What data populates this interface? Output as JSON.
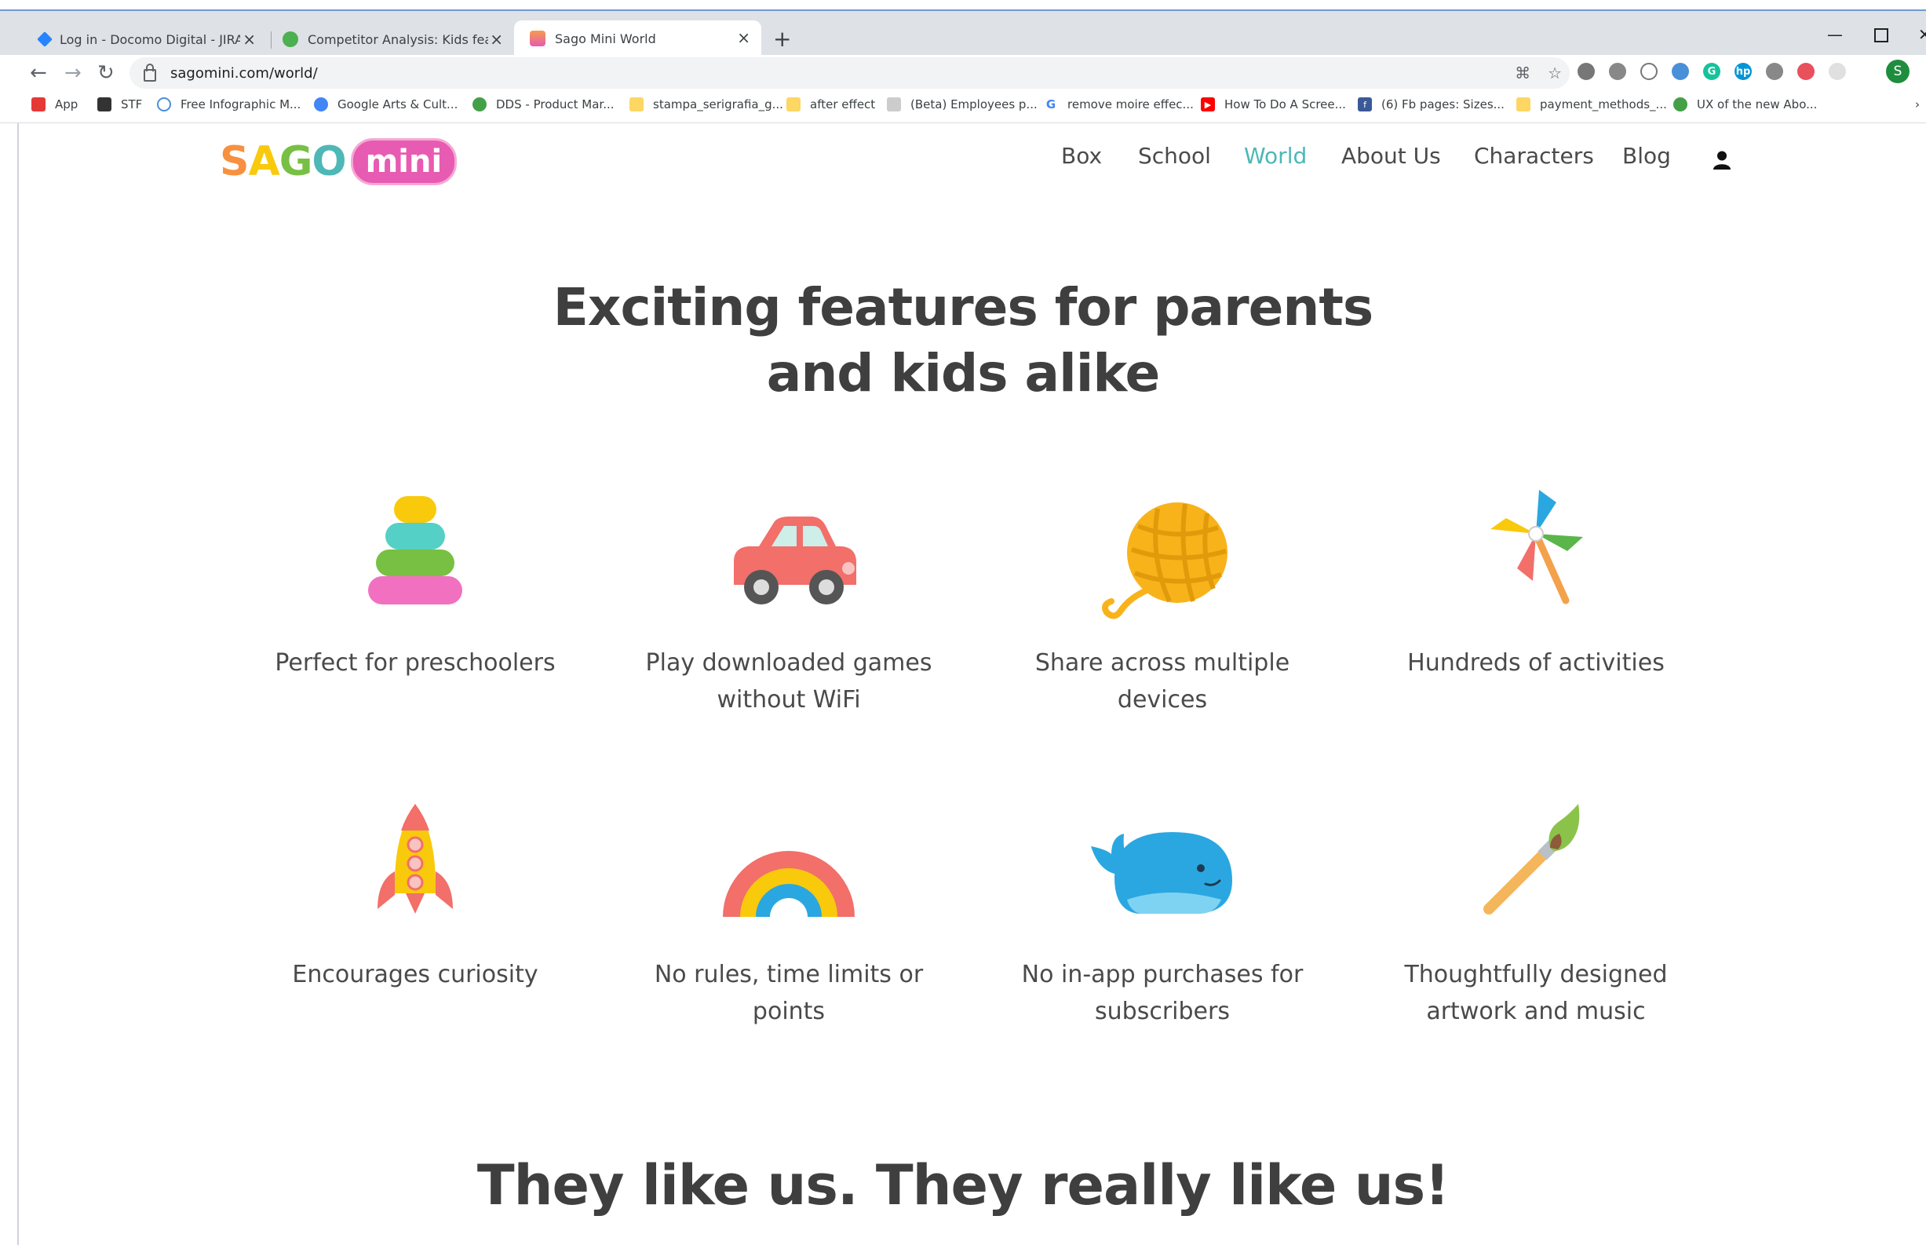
{
  "browser": {
    "tabs": [
      {
        "title": "Log in - Docomo Digital - JIRA"
      },
      {
        "title": "Competitor Analysis: Kids feature"
      },
      {
        "title": "Sago Mini World"
      }
    ],
    "url": "sagomini.com/world/",
    "profile_initial": "S",
    "bookmarks": [
      {
        "label": "App"
      },
      {
        "label": "STF"
      },
      {
        "label": "Free Infographic M..."
      },
      {
        "label": "Google Arts & Cult..."
      },
      {
        "label": "DDS - Product Mar..."
      },
      {
        "label": "stampa_serigrafia_g..."
      },
      {
        "label": "after effect"
      },
      {
        "label": "(Beta) Employees p..."
      },
      {
        "label": "remove moire effec..."
      },
      {
        "label": "How To Do A Scree..."
      },
      {
        "label": "(6) Fb pages: Sizes..."
      },
      {
        "label": "payment_methods_..."
      },
      {
        "label": "UX of the new Abo..."
      }
    ]
  },
  "site": {
    "logo": {
      "sago": "SAGO",
      "mini": "mini"
    },
    "nav": [
      {
        "label": "Box",
        "active": false
      },
      {
        "label": "School",
        "active": false
      },
      {
        "label": "World",
        "active": true
      },
      {
        "label": "About Us",
        "active": false
      },
      {
        "label": "Characters",
        "active": false
      },
      {
        "label": "Blog",
        "active": false
      }
    ],
    "nav_active_color": "#4db8b6"
  },
  "features_section": {
    "title_line1": "Exciting features for parents",
    "title_line2": "and kids alike",
    "features": [
      {
        "icon": "stacking-rings-icon",
        "line1": "Perfect for preschoolers",
        "line2": ""
      },
      {
        "icon": "toy-car-icon",
        "line1": "Play downloaded games",
        "line2": "without WiFi"
      },
      {
        "icon": "yarn-ball-icon",
        "line1": "Share across multiple",
        "line2": "devices"
      },
      {
        "icon": "pinwheel-icon",
        "line1": "Hundreds of activities",
        "line2": ""
      },
      {
        "icon": "rocket-icon",
        "line1": "Encourages curiosity",
        "line2": ""
      },
      {
        "icon": "rainbow-icon",
        "line1": "No rules, time limits or points",
        "line2": ""
      },
      {
        "icon": "whale-icon",
        "line1": "No in-app purchases for",
        "line2": "subscribers"
      },
      {
        "icon": "paintbrush-icon",
        "line1": "Thoughtfully designed",
        "line2": "artwork and music"
      }
    ]
  },
  "testimonials_section": {
    "title": "They like us. They really like us!"
  }
}
